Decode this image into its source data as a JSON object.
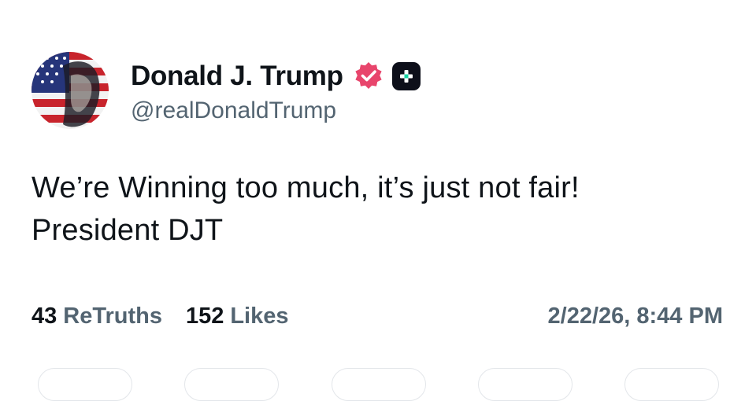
{
  "author": {
    "display_name": "Donald J. Trump",
    "handle": "@realDonaldTrump",
    "avatar_icon": "flag-portrait-avatar-icon",
    "verified_icon": "verified-badge-icon",
    "verified_color": "#e8456c",
    "plus_icon": "plus-square-icon"
  },
  "post": {
    "lines": [
      "We’re Winning too much, it’s just not fair!",
      "President DJT"
    ]
  },
  "stats": {
    "retruths_count": "43",
    "retruths_label": "ReTruths",
    "likes_count": "152",
    "likes_label": "Likes"
  },
  "timestamp": "2/22/26, 8:44 PM",
  "colors": {
    "text": "#0f1419",
    "muted": "#536471",
    "accent_plus": "#17d4a4"
  }
}
